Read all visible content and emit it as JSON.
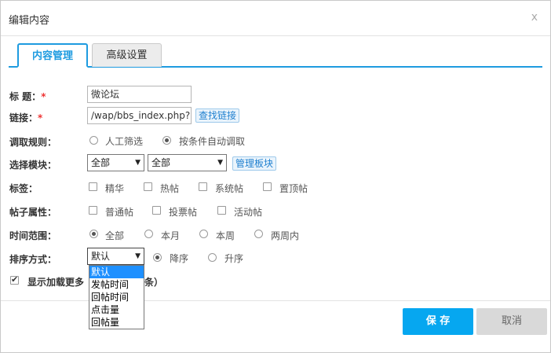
{
  "dialog": {
    "title": "编辑内容",
    "close_glyph": "x"
  },
  "tabs": [
    {
      "label": "内容管理",
      "active": true
    },
    {
      "label": "高级设置",
      "active": false
    }
  ],
  "form": {
    "title": {
      "label": "标 题：",
      "required": "*",
      "value": "微论坛"
    },
    "link": {
      "label": "链接：",
      "required": "*",
      "value": "/wap/bbs_index.php?u",
      "button": "查找链接"
    },
    "rule": {
      "label": "调取规则：",
      "options": [
        "人工筛选",
        "按条件自动调取"
      ],
      "selected": "按条件自动调取"
    },
    "module": {
      "label": "选择模块：",
      "select1": "全部",
      "select2": "全部",
      "button": "管理板块"
    },
    "tags": {
      "label": "标签：",
      "options": [
        "精华",
        "热帖",
        "系统帖",
        "置顶帖"
      ]
    },
    "attr": {
      "label": "帖子属性：",
      "options": [
        "普通帖",
        "投票帖",
        "活动帖"
      ]
    },
    "time": {
      "label": "时间范围：",
      "options": [
        "全部",
        "本月",
        "本周",
        "两周内"
      ],
      "selected": "全部"
    },
    "sort": {
      "label": "排序方式：",
      "select": "默认",
      "options": [
        "降序",
        "升序"
      ],
      "selected": "降序",
      "dropdown": [
        "默认",
        "发帖时间",
        "回帖时间",
        "点击量",
        "回帖量"
      ],
      "dropdown_selected": "默认"
    },
    "load_more": {
      "label": "显示加载更多（",
      "suffix": "条）",
      "checked": true
    }
  },
  "buttons": {
    "save": "保 存",
    "cancel": "取消"
  },
  "colors": {
    "accent": "#1e9be0",
    "save_bg": "#06a7f0",
    "cancel_bg": "#d9d9d9"
  }
}
